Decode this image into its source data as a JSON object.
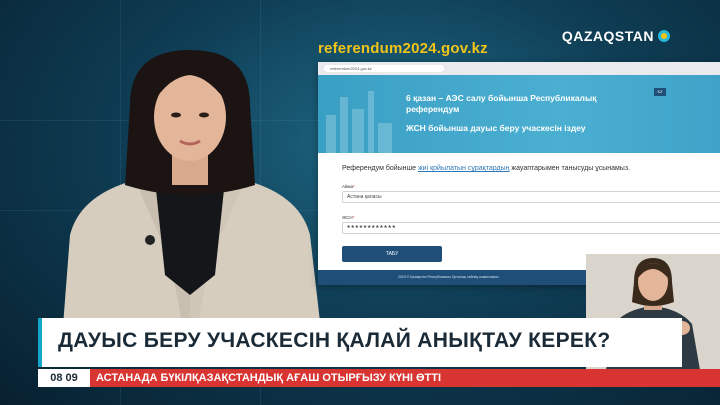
{
  "overlay": {
    "site_url": "referendum2024.gov.kz",
    "channel_logo": "QAZAQSTAN",
    "logo_icon": "qazaqstan-logo-icon"
  },
  "browser": {
    "address": "referendum2024.gov.kz",
    "language_button": "KZ",
    "header_title": "6 қазан – АЭС салу бойынша Республикалық референдум",
    "header_subtitle": "ЖСН бойынша дауыс беру учаскесін іздеу",
    "intro_before": "Референдум бойынше ",
    "intro_link": "жиі қойылатын сұрақтардың",
    "intro_after": " жауаптарымен танысуды ұсынамыз.",
    "city_label": "Айма",
    "city_value": "Астана қаласы",
    "iin_label": "ЖСН",
    "iin_value": "************",
    "search_button": "ТАБУ",
    "footer_text": "2024 © Қазақстан Республикасы Орталық сайлау комиссиясы"
  },
  "lower_third": {
    "headline": "ДАУЫС БЕРУ УЧАСКЕСІН ҚАЛАЙ АНЫҚТАУ КЕРЕК?",
    "time": "08 09",
    "ticker": "АСТАНАДА БҮКІЛҚАЗАҚСТАНДЫҚ АҒАШ ОТЫРҒЫЗУ КҮНІ ӨТТІ"
  },
  "colors": {
    "accent_yellow": "#f0c419",
    "header_blue": "#3a9fc4",
    "button_navy": "#1f4e79",
    "ticker_red": "#d83432"
  }
}
